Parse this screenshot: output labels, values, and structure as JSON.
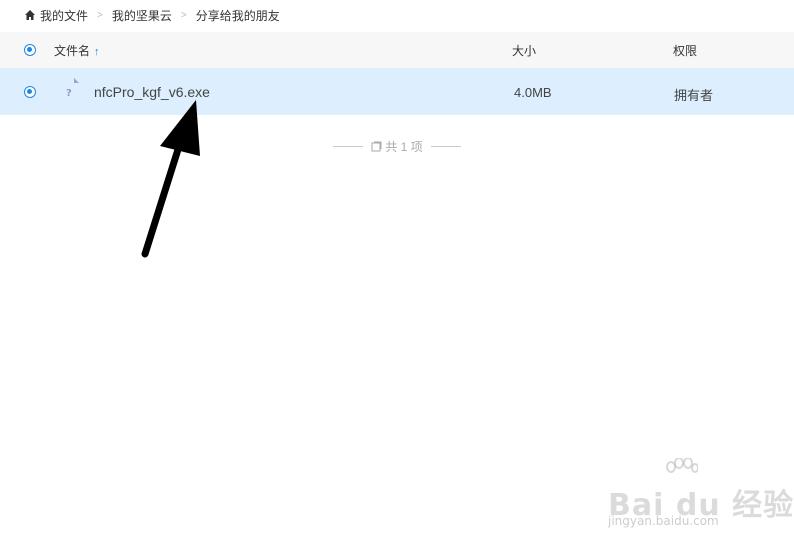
{
  "breadcrumb": {
    "items": [
      "我的文件",
      "我的坚果云",
      "分享给我的朋友"
    ],
    "separator": ">"
  },
  "table": {
    "columns": {
      "name": "文件名",
      "size": "大小",
      "permission": "权限"
    },
    "sort_indicator": "↑",
    "rows": [
      {
        "name": "nfcPro_kgf_v6.exe",
        "size": "4.0MB",
        "permission": "拥有者",
        "icon": "unknown-file-icon",
        "icon_glyph": "?"
      }
    ]
  },
  "footer": {
    "count_text": "共 1 项"
  },
  "watermark": {
    "logo": "Bai du 经验",
    "url": "jingyan.baidu.com"
  },
  "colors": {
    "accent": "#1e88e5",
    "selected_row": "#ddeefe",
    "header_bg": "#f7f7f7"
  }
}
